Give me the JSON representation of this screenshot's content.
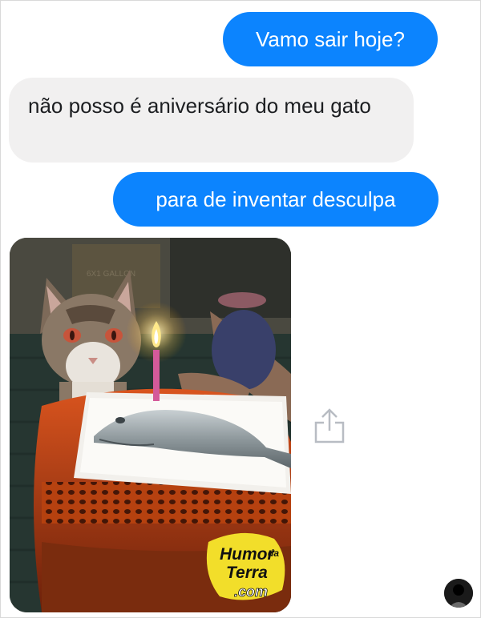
{
  "conversation": {
    "messages": [
      {
        "sender": "me",
        "text": "Vamo sair hoje?"
      },
      {
        "sender": "friend",
        "text": "não posso é aniversário do meu gato"
      },
      {
        "sender": "me",
        "text": "para de inventar desculpa"
      }
    ],
    "photo": {
      "box_label": "6X1 GALLON",
      "watermark": {
        "line1": "Humor",
        "line2": "da",
        "line3": "Terra",
        "line4": ".com"
      }
    },
    "share_icon": "share-icon",
    "avatar_icon": "avatar"
  },
  "colors": {
    "sent_bubble": "#0c84fe",
    "received_bubble": "#f1f0f0",
    "share_icon": "#b8bcc3"
  }
}
